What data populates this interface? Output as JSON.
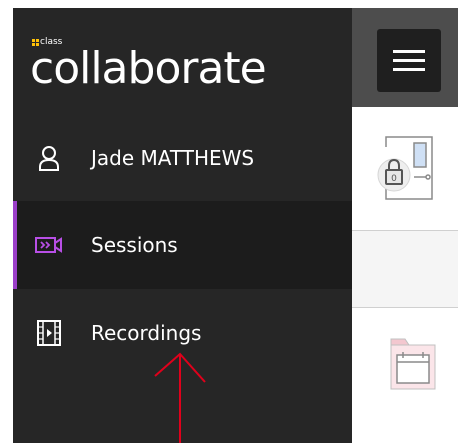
{
  "app": {
    "brand_small": "class",
    "brand_large": "collaborate",
    "accent_color": "#9b3fc9",
    "brand_mark_color": "#ffc107",
    "annotation_color": "#e0001b"
  },
  "sidebar": {
    "items": [
      {
        "label": "Jade MATTHEWS",
        "icon": "user-icon"
      },
      {
        "label": "Sessions",
        "icon": "sessions-icon",
        "active": true
      },
      {
        "label": "Recordings",
        "icon": "recordings-icon"
      }
    ]
  },
  "topbar": {
    "menu_icon": "hamburger-menu-icon"
  },
  "main": {
    "room_icon": "locked-room-icon",
    "calendar_icon": "calendar-icon"
  },
  "annotation": {
    "shape": "arrow-up",
    "target": "Recordings"
  }
}
